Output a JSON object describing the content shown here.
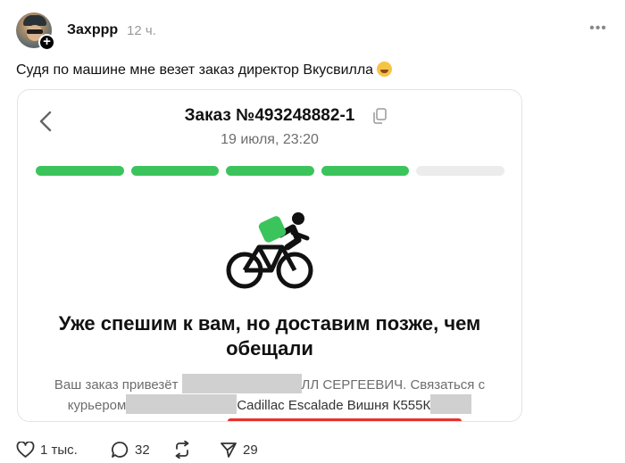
{
  "post": {
    "username": "Захррр",
    "time": "12 ч.",
    "text": "Судя по машине мне везет заказ директор Вкусвилла",
    "emoji": "grinning-squinting-face"
  },
  "order": {
    "title": "Заказ №493248882-1",
    "date": "19 июля, 23:20",
    "progress": {
      "total_steps": 5,
      "completed_steps": 4,
      "active_color": "#3cc45c",
      "inactive_color": "#ececec"
    },
    "status_title": "Уже спешим к вам, но доставим позже, чем обещали",
    "status_line1_a": "Ваш заказ привезёт",
    "status_line1_b": "ЛЛ СЕРГЕЕВИЧ. Связаться с",
    "status_line2_a": "курьером",
    "status_line2_b": "Cadillac Escalade Вишня К555К",
    "accent_underline": "#e8312d"
  },
  "actions": {
    "likes": "1 тыс.",
    "comments": "32",
    "reposts": "",
    "shares": "29"
  }
}
